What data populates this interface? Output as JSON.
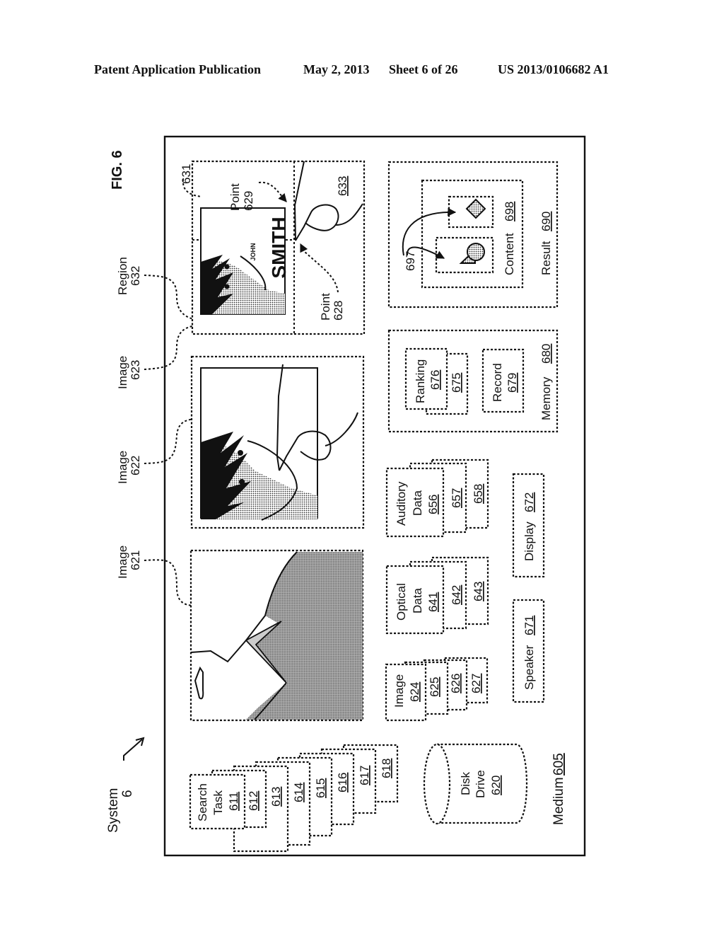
{
  "header": {
    "publication": "Patent Application Publication",
    "date": "May 2, 2013",
    "sheet": "Sheet 6 of 26",
    "number": "US 2013/0106682 A1"
  },
  "figure": {
    "title": "FIG. 6",
    "system": {
      "label": "System",
      "ref": "6"
    },
    "medium": {
      "label": "Medium",
      "ref": "605"
    },
    "callouts": {
      "image621": {
        "label": "Image",
        "ref": "621"
      },
      "image622": {
        "label": "Image",
        "ref": "622"
      },
      "image623": {
        "label": "Image",
        "ref": "623"
      },
      "region632": {
        "label": "Region",
        "ref": "632"
      },
      "ref631": "631",
      "point628": {
        "label": "Point",
        "ref": "628"
      },
      "point629": {
        "label": "Point",
        "ref": "629"
      },
      "ref633": "633",
      "ref697": "697"
    },
    "name_card": {
      "first": "JOHN",
      "last": "SMITH"
    },
    "search_tasks": {
      "first": {
        "line1": "Search",
        "line2": "Task",
        "ref": "611"
      },
      "refs": [
        "612",
        "613",
        "614",
        "615",
        "616",
        "617",
        "618"
      ]
    },
    "disk_drive": {
      "line1": "Disk",
      "line2": "Drive",
      "ref": "620"
    },
    "images_stack": {
      "label": "Image",
      "ref": "624",
      "refs": [
        "625",
        "626",
        "627"
      ]
    },
    "optical_stack": {
      "line1": "Optical",
      "line2": "Data",
      "ref": "641",
      "refs": [
        "642",
        "643"
      ]
    },
    "auditory_stack": {
      "line1": "Auditory",
      "line2": "Data",
      "ref": "656",
      "refs": [
        "657",
        "658"
      ]
    },
    "speaker": {
      "label": "Speaker",
      "ref": "671"
    },
    "display": {
      "label": "Display",
      "ref": "672"
    },
    "memory": {
      "label": "Memory",
      "ref": "680",
      "ranking": {
        "label": "Ranking",
        "ref": "676",
        "behind_ref": "675"
      },
      "record": {
        "label": "Record",
        "ref": "679"
      }
    },
    "result": {
      "label": "Result",
      "ref": "690",
      "content": {
        "label": "Content",
        "ref": "698"
      }
    }
  }
}
